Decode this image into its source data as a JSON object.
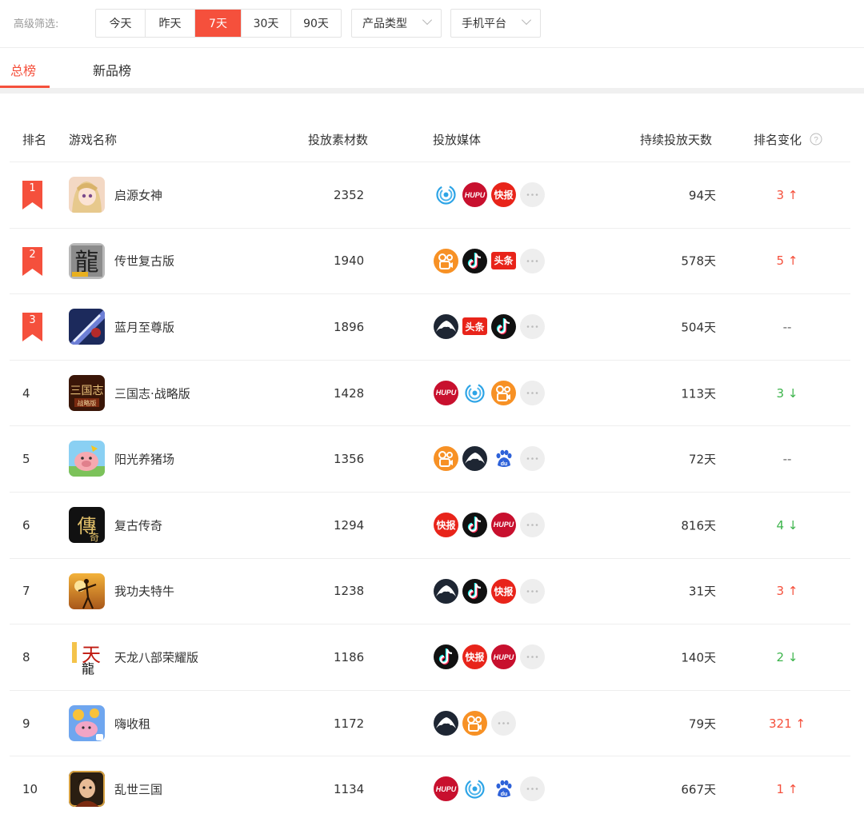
{
  "filter": {
    "label": "高级筛选:",
    "periods": [
      "今天",
      "昨天",
      "7天",
      "30天",
      "90天"
    ],
    "active_period": "7天",
    "product_type": "产品类型",
    "platform": "手机平台"
  },
  "tabs": [
    {
      "label": "总榜",
      "active": true
    },
    {
      "label": "新品榜",
      "active": false
    }
  ],
  "table": {
    "headers": {
      "rank": "排名",
      "name": "游戏名称",
      "count": "投放素材数",
      "media": "投放媒体",
      "days": "持续投放天数",
      "change": "排名变化"
    },
    "rows": [
      {
        "rank": "1",
        "name": "启源女神",
        "count": "2352",
        "media": [
          "wave",
          "hupu",
          "kuaibao",
          "more"
        ],
        "days": "94天",
        "change": "3",
        "dir": "up"
      },
      {
        "rank": "2",
        "name": "传世复古版",
        "count": "1940",
        "media": [
          "kuaishou",
          "douyin",
          "toutiao",
          "more"
        ],
        "days": "578天",
        "change": "5",
        "dir": "up"
      },
      {
        "rank": "3",
        "name": "蓝月至尊版",
        "count": "1896",
        "media": [
          "eagle",
          "toutiao",
          "douyin",
          "more"
        ],
        "days": "504天",
        "change": "--",
        "dir": "flat"
      },
      {
        "rank": "4",
        "name": "三国志·战略版",
        "count": "1428",
        "media": [
          "hupu",
          "wave",
          "kuaishou",
          "more"
        ],
        "days": "113天",
        "change": "3",
        "dir": "down"
      },
      {
        "rank": "5",
        "name": "阳光养猪场",
        "count": "1356",
        "media": [
          "kuaishou",
          "eagle",
          "baidu",
          "more"
        ],
        "days": "72天",
        "change": "--",
        "dir": "flat"
      },
      {
        "rank": "6",
        "name": "复古传奇",
        "count": "1294",
        "media": [
          "kuaibao",
          "douyin",
          "hupu",
          "more"
        ],
        "days": "816天",
        "change": "4",
        "dir": "down"
      },
      {
        "rank": "7",
        "name": "我功夫特牛",
        "count": "1238",
        "media": [
          "eagle",
          "douyin",
          "kuaibao",
          "more"
        ],
        "days": "31天",
        "change": "3",
        "dir": "up"
      },
      {
        "rank": "8",
        "name": "天龙八部荣耀版",
        "count": "1186",
        "media": [
          "douyin",
          "kuaibao",
          "hupu",
          "more"
        ],
        "days": "140天",
        "change": "2",
        "dir": "down"
      },
      {
        "rank": "9",
        "name": "嗨收租",
        "count": "1172",
        "media": [
          "eagle",
          "kuaishou",
          "more"
        ],
        "days": "79天",
        "change": "321",
        "dir": "up"
      },
      {
        "rank": "10",
        "name": "乱世三国",
        "count": "1134",
        "media": [
          "hupu",
          "wave",
          "baidu",
          "more"
        ],
        "days": "667天",
        "change": "1",
        "dir": "up"
      }
    ]
  },
  "media_labels": {
    "hupu": "HUPU",
    "kuaibao": "快报",
    "toutiao": "头条",
    "baidu": "du"
  },
  "colors": {
    "accent": "#f5503c",
    "up": "#f5503c",
    "down": "#3cb44b"
  }
}
